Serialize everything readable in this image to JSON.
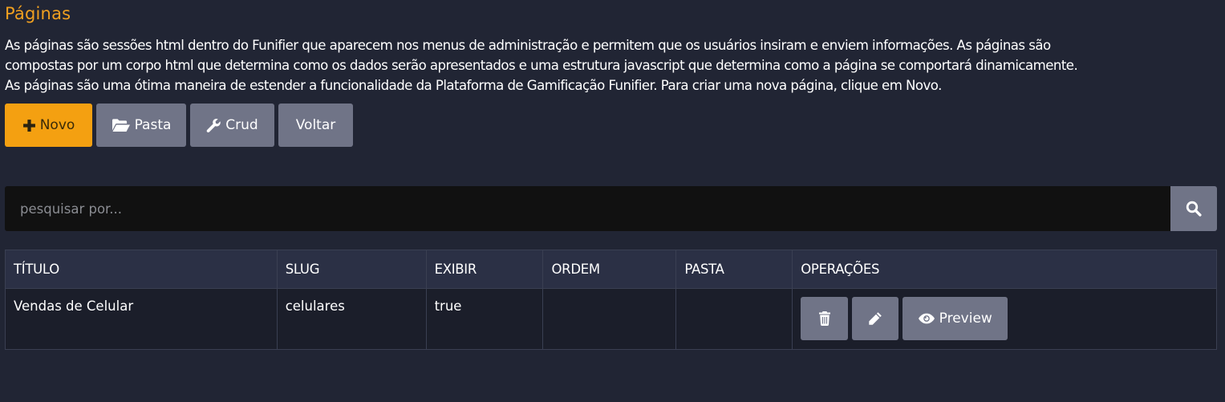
{
  "page": {
    "title": "Páginas",
    "description": [
      "As páginas são sessões html dentro do Funifier que aparecem nos menus de administração e permitem que os usuários insiram e enviem informações. As páginas são",
      "compostas por um corpo html que determina como os dados serão apresentados e uma estrutura javascript que determina como a página se comportará dinamicamente.",
      "As páginas são uma ótima maneira de estender a funcionalidade da Plataforma de Gamificação Funifier. Para criar uma nova página, clique em Novo."
    ]
  },
  "toolbar": {
    "novo_label": "Novo",
    "pasta_label": "Pasta",
    "crud_label": "Crud",
    "voltar_label": "Voltar"
  },
  "search": {
    "placeholder": "pesquisar por..."
  },
  "table": {
    "headers": [
      "TÍTULO",
      "SLUG",
      "EXIBIR",
      "ORDEM",
      "PASTA",
      "OPERAÇÕES"
    ],
    "rows": [
      {
        "titulo": "Vendas de Celular",
        "slug": "celulares",
        "exibir": "true",
        "ordem": "",
        "pasta": "",
        "preview_label": "Preview"
      }
    ]
  },
  "colors": {
    "background": "#212534",
    "accent": "#f4a011",
    "title": "#f0a020",
    "button": "#707487",
    "search_bg": "#111111",
    "header_bg": "#2b3045",
    "row_bg": "#1b1e2a"
  },
  "icons": {
    "novo": "plus-icon",
    "pasta": "folder-open-icon",
    "crud": "wrench-icon",
    "search": "search-icon",
    "delete": "trash-icon",
    "edit": "pencil-icon",
    "preview": "eye-icon"
  }
}
